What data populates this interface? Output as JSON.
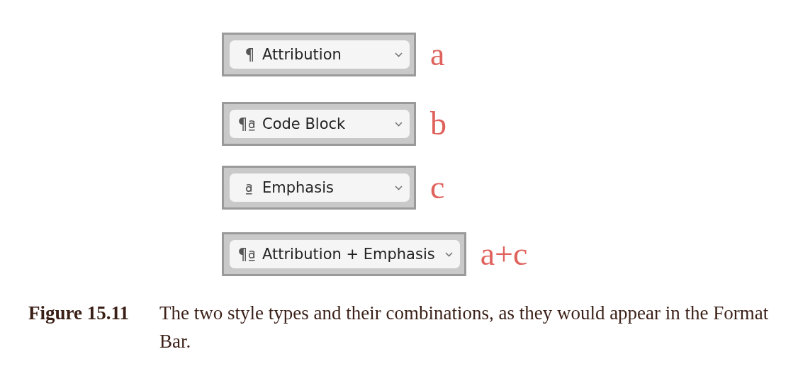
{
  "dropdowns": [
    {
      "kind": "paragraph",
      "label": "Attribution",
      "tag": "a"
    },
    {
      "kind": "both",
      "label": "Code Block",
      "tag": "b"
    },
    {
      "kind": "character",
      "label": "Emphasis",
      "tag": "c"
    },
    {
      "kind": "both",
      "label": "Attribution + Emphasis",
      "tag": "a+c"
    }
  ],
  "caption": {
    "number": "Figure 15.11",
    "text": "The two style types and their combinations, as they would appear in the Format Bar."
  }
}
